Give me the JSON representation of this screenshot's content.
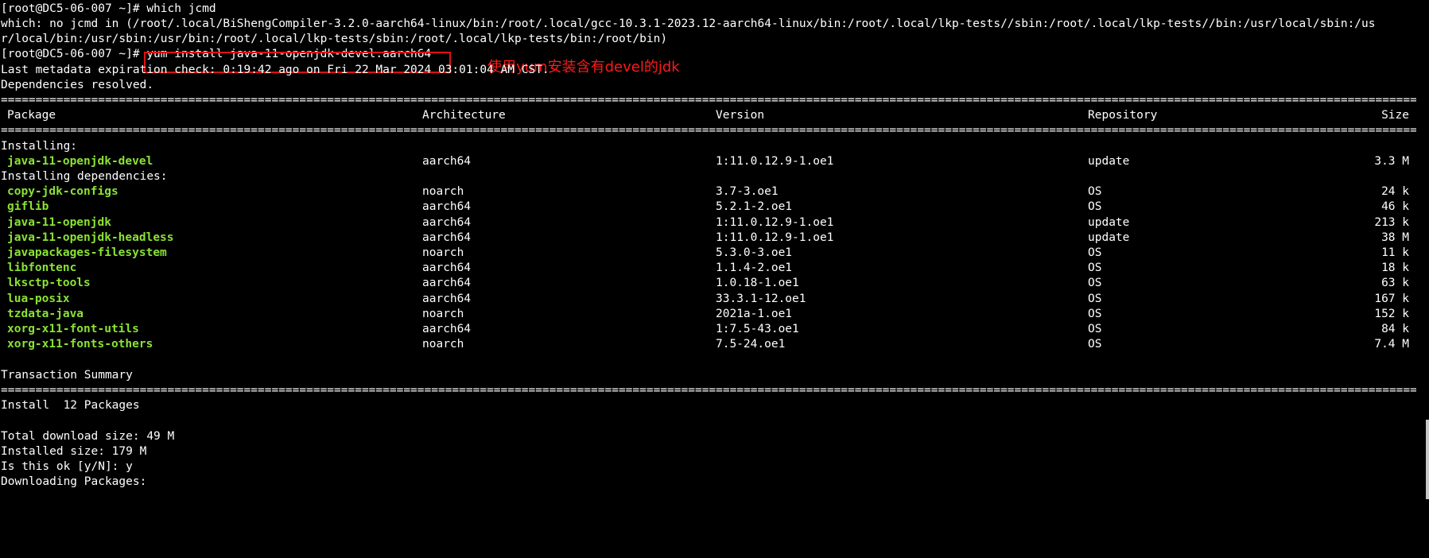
{
  "terminal": {
    "lines": {
      "cmd_which": "[root@DC5-06-007 ~]# which jcmd",
      "which_out_1": "which: no jcmd in (/root/.local/BiShengCompiler-3.2.0-aarch64-linux/bin:/root/.local/gcc-10.3.1-2023.12-aarch64-linux/bin:/root/.local/lkp-tests//sbin:/root/.local/lkp-tests//bin:/usr/local/sbin:/us",
      "which_out_2": "r/local/bin:/usr/sbin:/usr/bin:/root/.local/lkp-tests/sbin:/root/.local/lkp-tests/bin:/root/bin)",
      "prompt2": "[root@DC5-06-007 ~]# ",
      "cmd_yum": "yum install java-11-openjdk-devel.aarch64",
      "metadata": "Last metadata expiration check: 0:19:42 ago on Fri 22 Mar 2024 03:01:04 AM CST.",
      "deps_resolved": "Dependencies resolved.",
      "installing": "Installing:",
      "installing_deps": "Installing dependencies:",
      "txn_summary": "Transaction Summary",
      "install_count": "Install  12 Packages",
      "total_download": "Total download size: 49 M",
      "installed_size": "Installed size: 179 M",
      "confirm": "Is this ok [y/N]: y",
      "downloading": "Downloading Packages:"
    },
    "separator": "================================================================================================================================================================================================================================================",
    "table": {
      "headers": {
        "package": "Package",
        "architecture": "Architecture",
        "version": "Version",
        "repository": "Repository",
        "size": "Size"
      },
      "main_rows": [
        {
          "package": "java-11-openjdk-devel",
          "arch": "aarch64",
          "version": "1:11.0.12.9-1.oe1",
          "repo": "update",
          "size": "3.3 M"
        }
      ],
      "dep_rows": [
        {
          "package": "copy-jdk-configs",
          "arch": "noarch",
          "version": "3.7-3.oe1",
          "repo": "OS",
          "size": "24 k"
        },
        {
          "package": "giflib",
          "arch": "aarch64",
          "version": "5.2.1-2.oe1",
          "repo": "OS",
          "size": "46 k"
        },
        {
          "package": "java-11-openjdk",
          "arch": "aarch64",
          "version": "1:11.0.12.9-1.oe1",
          "repo": "update",
          "size": "213 k"
        },
        {
          "package": "java-11-openjdk-headless",
          "arch": "aarch64",
          "version": "1:11.0.12.9-1.oe1",
          "repo": "update",
          "size": "38 M"
        },
        {
          "package": "javapackages-filesystem",
          "arch": "noarch",
          "version": "5.3.0-3.oe1",
          "repo": "OS",
          "size": "11 k"
        },
        {
          "package": "libfontenc",
          "arch": "aarch64",
          "version": "1.1.4-2.oe1",
          "repo": "OS",
          "size": "18 k"
        },
        {
          "package": "lksctp-tools",
          "arch": "aarch64",
          "version": "1.0.18-1.oe1",
          "repo": "OS",
          "size": "63 k"
        },
        {
          "package": "lua-posix",
          "arch": "aarch64",
          "version": "33.3.1-12.oe1",
          "repo": "OS",
          "size": "167 k"
        },
        {
          "package": "tzdata-java",
          "arch": "noarch",
          "version": "2021a-1.oe1",
          "repo": "OS",
          "size": "152 k"
        },
        {
          "package": "xorg-x11-font-utils",
          "arch": "aarch64",
          "version": "1:7.5-43.oe1",
          "repo": "OS",
          "size": "84 k"
        },
        {
          "package": "xorg-x11-fonts-others",
          "arch": "noarch",
          "version": "7.5-24.oe1",
          "repo": "OS",
          "size": "7.4 M"
        }
      ]
    },
    "annotation": "使用yum安装含有devel的jdk",
    "colors": {
      "background": "#000000",
      "foreground": "#ffffff",
      "package_name": "#8ae234",
      "annotation": "#ff1a1a"
    }
  }
}
